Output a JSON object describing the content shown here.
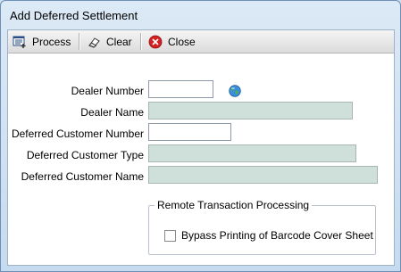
{
  "window": {
    "title": "Add Deferred Settlement"
  },
  "toolbar": {
    "process_label": "Process",
    "clear_label": "Clear",
    "close_label": "Close"
  },
  "form": {
    "dealer_number": {
      "label": "Dealer Number",
      "value": ""
    },
    "dealer_name": {
      "label": "Dealer Name",
      "value": ""
    },
    "deferred_customer_number": {
      "label": "Deferred Customer Number",
      "value": ""
    },
    "deferred_customer_type": {
      "label": "Deferred Customer Type",
      "value": ""
    },
    "deferred_customer_name": {
      "label": "Deferred Customer Name",
      "value": ""
    }
  },
  "remote": {
    "group_title": "Remote Transaction Processing",
    "bypass_label": "Bypass Printing of Barcode Cover Sheet",
    "bypass_checked": false
  },
  "icons": [
    "process-icon",
    "eraser-icon",
    "close-icon",
    "globe-lookup-icon",
    "checkbox"
  ],
  "colors": {
    "close_red": "#d42020",
    "readonly_field": "#cfe0da"
  }
}
